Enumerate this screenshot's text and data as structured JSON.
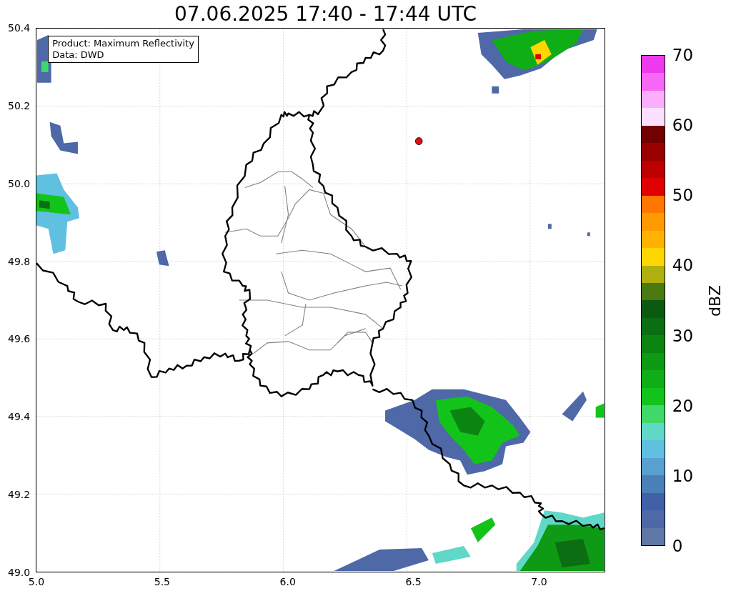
{
  "title": "07.06.2025 17:40 - 17:44 UTC",
  "legend": [
    "Product: Maximum Reflectivity",
    "Data: DWD"
  ],
  "axes": {
    "xticks": [
      "5.0",
      "5.5",
      "6.0",
      "6.5",
      "7.0"
    ],
    "yticks": [
      "50.4",
      "50.2",
      "50.0",
      "49.8",
      "49.6",
      "49.4",
      "49.2",
      "49.0"
    ]
  },
  "colorbar": {
    "label": "dBZ",
    "ticks": [
      "70",
      "60",
      "50",
      "40",
      "30",
      "20",
      "10",
      "0"
    ]
  }
}
